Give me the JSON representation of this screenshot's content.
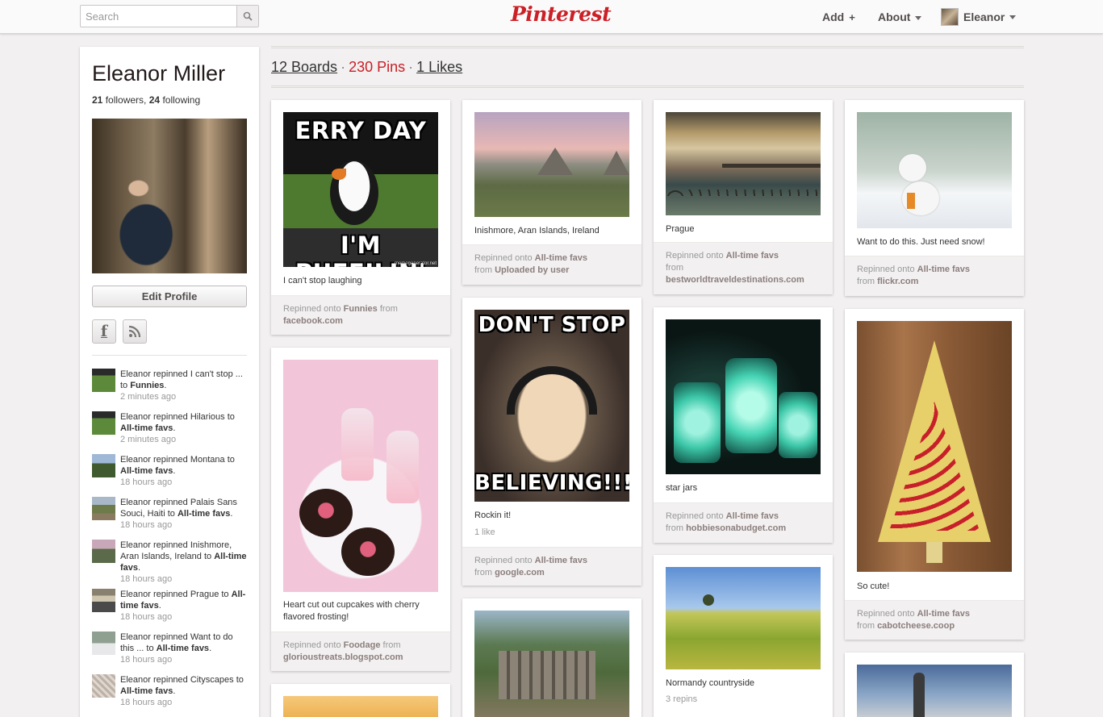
{
  "header": {
    "search_placeholder": "Search",
    "logo": "Pinterest",
    "nav_add": "Add",
    "nav_add_plus": "+",
    "nav_about": "About",
    "nav_user": "Eleanor"
  },
  "profile": {
    "name": "Eleanor Miller",
    "followers": "21",
    "followers_label": "followers,",
    "following": "24",
    "following_label": "following",
    "edit_button": "Edit Profile",
    "facebook_glyph": "f"
  },
  "activity": [
    {
      "text": "Eleanor repinned I can't stop ... to",
      "board": "Funnies",
      "suffix": ".",
      "time": "2 minutes ago"
    },
    {
      "text": "Eleanor repinned Hilarious to",
      "board": "All-time favs",
      "suffix": ".",
      "time": "2 minutes ago"
    },
    {
      "text": "Eleanor repinned Montana to",
      "board": "All-time favs",
      "suffix": ".",
      "time": "18 hours ago"
    },
    {
      "text": "Eleanor repinned Palais Sans Souci, Haiti to",
      "board": "All-time favs",
      "suffix": ".",
      "time": "18 hours ago"
    },
    {
      "text": "Eleanor repinned Inishmore, Aran Islands, Ireland to",
      "board": "All-time favs",
      "suffix": ".",
      "time": "18 hours ago"
    },
    {
      "text": "Eleanor repinned Prague to",
      "board": "All-time favs",
      "suffix": ".",
      "time": "18 hours ago"
    },
    {
      "text": "Eleanor repinned Want to do this ... to",
      "board": "All-time favs",
      "suffix": ".",
      "time": "18 hours ago"
    },
    {
      "text": "Eleanor repinned Cityscapes to",
      "board": "All-time favs",
      "suffix": ".",
      "time": "18 hours ago"
    }
  ],
  "stats": {
    "boards": "12 Boards",
    "pins": "230 Pins",
    "likes": "1 Likes",
    "separator": "·"
  },
  "pins": {
    "puffin": {
      "meme_top": "ERRY DAY",
      "meme_bottom": "I'M PUFFILIN'",
      "watermark": "memegenerator.net",
      "desc": "I can't stop laughing",
      "repinned": "Repinned onto",
      "board": "Funnies",
      "from_word": "from",
      "source": "facebook.com"
    },
    "cupcakes": {
      "desc": "Heart cut out cupcakes with cherry flavored frosting!",
      "repinned": "Repinned onto",
      "board": "Foodage",
      "from_word": "from",
      "source": "glorioustreats.blogspot.com"
    },
    "inishmore": {
      "desc": "Inishmore, Aran Islands, Ireland",
      "repinned": "Repinned onto",
      "board": "All-time favs",
      "from_word": "from",
      "source": "Uploaded by user"
    },
    "baby": {
      "meme_top": "DON'T STOP",
      "meme_bottom": "BELIEVING!!!",
      "desc": "Rockin it!",
      "likes": "1 like",
      "repinned": "Repinned onto",
      "board": "All-time favs",
      "from_word": "from",
      "source": "google.com"
    },
    "prague": {
      "desc": "Prague",
      "repinned": "Repinned onto",
      "board": "All-time favs",
      "from_word": "from",
      "source": "bestworldtraveldestinations.com"
    },
    "starjars": {
      "desc": "star jars",
      "repinned": "Repinned onto",
      "board": "All-time favs",
      "from_word": "from",
      "source": "hobbiesonabudget.com"
    },
    "normandy": {
      "desc": "Normandy countryside",
      "repins": "3 repins"
    },
    "snowman": {
      "desc": "Want to do this. Just need snow!",
      "repinned": "Repinned onto",
      "board": "All-time favs",
      "from_word": "from",
      "source": "flickr.com"
    },
    "cheese": {
      "desc": "So cute!",
      "repinned": "Repinned onto",
      "board": "All-time favs",
      "from_word": "from",
      "source": "cabotcheese.coop"
    }
  },
  "colors": {
    "brand_red": "#cb2027",
    "background": "#f2f0f0"
  }
}
